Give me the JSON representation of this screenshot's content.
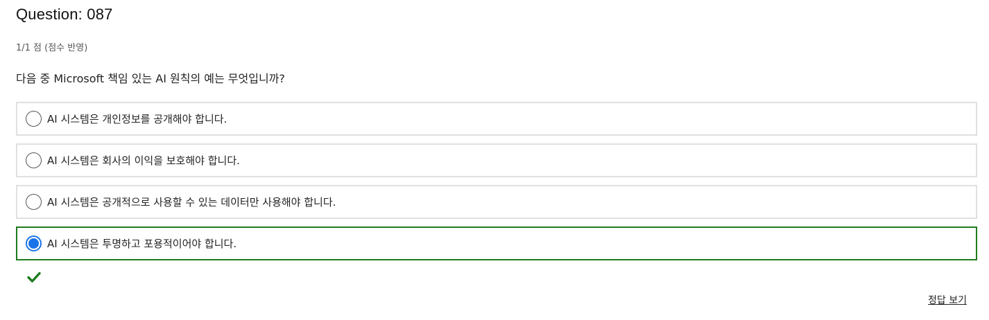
{
  "question": {
    "title": "Question: 087",
    "score": "1/1 점 (점수 반영)",
    "text": "다음 중 Microsoft 책임 있는 AI 원칙의 예는 무엇입니까?"
  },
  "options": [
    {
      "label": "AI 시스템은 개인정보를 공개해야 합니다.",
      "selected": false
    },
    {
      "label": "AI 시스템은 회사의 이익을 보호해야 합니다.",
      "selected": false
    },
    {
      "label": "AI 시스템은 공개적으로 사용할 수 있는 데이터만 사용해야 합니다.",
      "selected": false
    },
    {
      "label": "AI 시스템은 투명하고 포용적이어야 합니다.",
      "selected": true
    }
  ],
  "result": {
    "icon": "checkmark-icon",
    "color": "#1e7b1e"
  },
  "actions": {
    "view_answer": "정답 보기"
  },
  "colors": {
    "selected_border": "#1e7b1e",
    "radio_selected": "#1a73e8",
    "option_border": "#e0e0e0"
  }
}
